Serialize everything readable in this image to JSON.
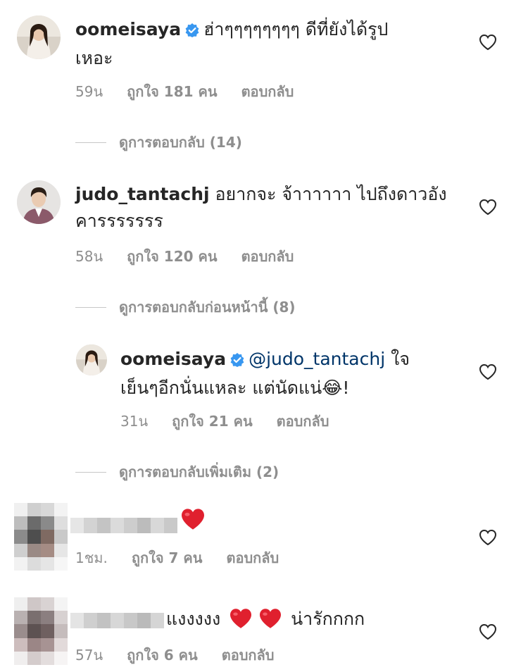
{
  "comments": [
    {
      "username": "oomeisaya",
      "verified": true,
      "text_line1": "ฮ่าๆๆๆๆๆๆๆๆ ดีที่ยังได้รูป",
      "text_line2": "เหอะ",
      "time": "59น",
      "likes": "ถูกใจ 181 คน",
      "reply_label": "ตอบกลับ",
      "view_replies": "ดูการตอบกลับ (14)"
    },
    {
      "username": "judo_tantachj",
      "verified": false,
      "text_line1": "อยากจะ จ้าาาาาา ไปถึงดาวอัง",
      "text_line2": "คารรรรรรร",
      "time": "58น",
      "likes": "ถูกใจ 120 คน",
      "reply_label": "ตอบกลับ",
      "view_replies": "ดูการตอบกลับก่อนหน้านี้ (8)"
    },
    {
      "username": "oomeisaya",
      "verified": true,
      "mention": "@judo_tantachj",
      "text_line1_rest": "ใจ",
      "text_line2": "เย็นๆอีกนั่นแหละ แต่นัดแน่😂!",
      "time": "31น",
      "likes": "ถูกใจ 21 คน",
      "reply_label": "ตอบกลับ",
      "view_replies": "ดูการตอบกลับเพิ่มเติม (2)"
    },
    {
      "username_blurred": true,
      "text": "❤️",
      "time": "1ชม.",
      "likes": "ถูกใจ 7 คน",
      "reply_label": "ตอบกลับ"
    },
    {
      "username_blurred": true,
      "text_before": "แงงงงง",
      "text_after": "น่ารักกกก",
      "time": "57น",
      "likes": "ถูกใจ 6 คน",
      "reply_label": "ตอบกลับ"
    }
  ],
  "colors": {
    "text": "#262626",
    "meta": "#8e8e8e",
    "verified": "#3897f0",
    "mention": "#003569",
    "heart_emoji": "#e0202e"
  },
  "icons": {
    "like": "heart-outline-icon",
    "verified": "verified-badge-icon"
  }
}
